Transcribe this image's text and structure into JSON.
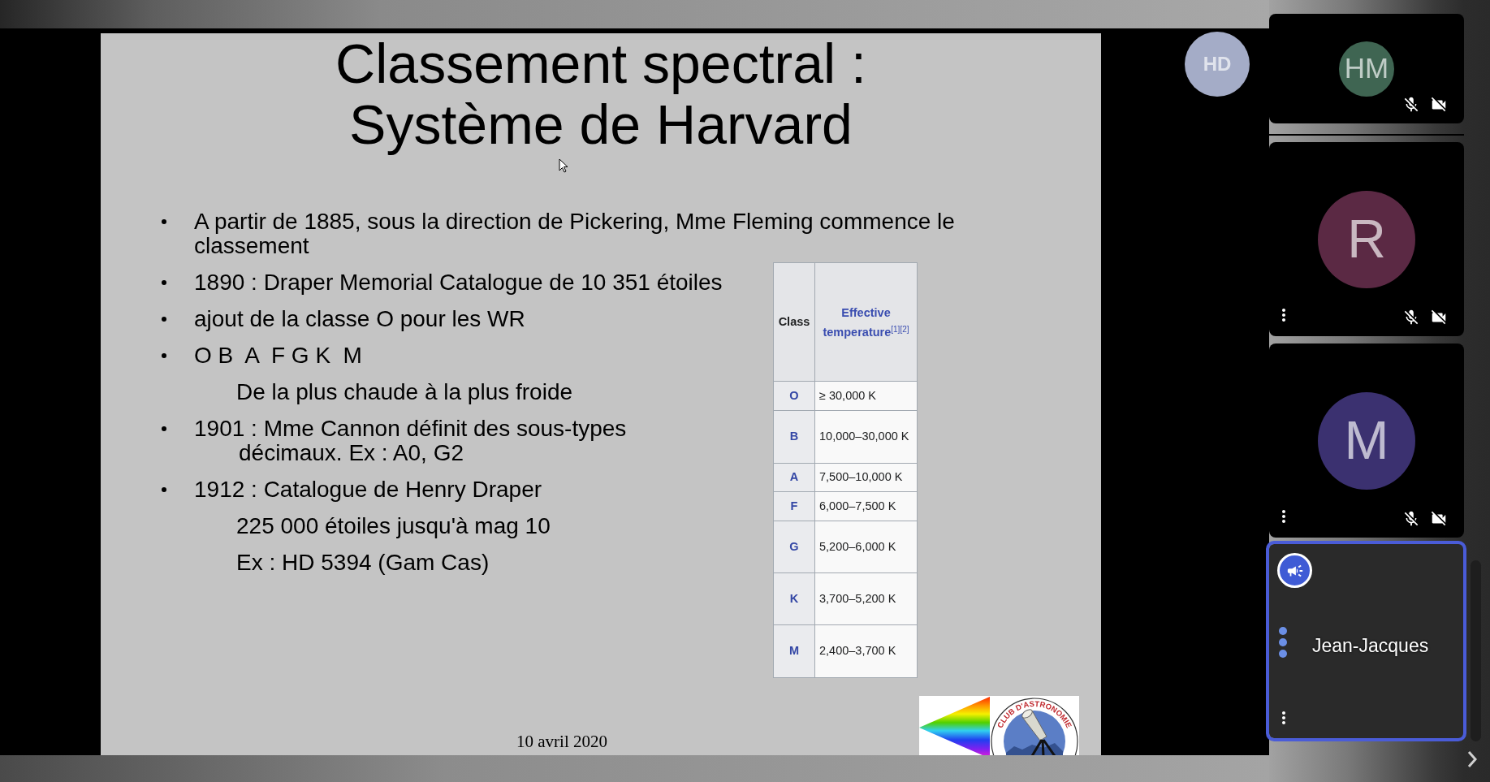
{
  "stage": {
    "avatar": {
      "initials": "HD"
    }
  },
  "slide": {
    "title": "Classement spectral : Système de Harvard",
    "bullets": [
      {
        "kind": "bullet",
        "text": "A partir de 1885, sous la direction de Pickering, Mme Fleming commence le classement"
      },
      {
        "kind": "bullet",
        "text": "1890 : Draper Memorial Catalogue de 10 351 étoiles"
      },
      {
        "kind": "bullet",
        "text": "ajout de la classe O pour les WR"
      },
      {
        "kind": "bullet",
        "text": "O B  A  F G K  M"
      },
      {
        "kind": "sub",
        "text": "De la plus chaude à la plus froide"
      },
      {
        "kind": "bullet",
        "text": "1901 : Mme Cannon définit des sous-types\ndécimaux. Ex : A0, G2"
      },
      {
        "kind": "bullet",
        "text": "1912 : Catalogue de Henry Draper"
      },
      {
        "kind": "sub",
        "text": "225 000 étoiles jusqu'à mag 10"
      },
      {
        "kind": "sub",
        "text": "Ex : HD 5394 (Gam Cas)"
      }
    ],
    "table": {
      "columns": [
        "Class",
        "Effective temperature$^{[1][2]}$"
      ],
      "rows": [
        {
          "class": "O",
          "temperature": "≥ 30,000 K"
        },
        {
          "class": "B",
          "temperature": "10,000–30,000 K"
        },
        {
          "class": "A",
          "temperature": "7,500–10,000 K"
        },
        {
          "class": "F",
          "temperature": "6,000–7,500 K"
        },
        {
          "class": "G",
          "temperature": "5,200–6,000 K"
        },
        {
          "class": "K",
          "temperature": "3,700–5,200 K"
        },
        {
          "class": "M",
          "temperature": "2,400–3,700 K"
        }
      ]
    },
    "date": "10 avril 2020",
    "logo": {
      "text": "CLUB D'ASTRONOMIE"
    }
  },
  "filmstrip": {
    "participants": [
      {
        "kind": "local",
        "initials": "HM",
        "color": "#3f6552",
        "audio_muted": true,
        "video_muted": true,
        "menu_button": false,
        "active_speaker": false
      },
      {
        "kind": "remote",
        "initials": "R",
        "color": "#5b2944",
        "audio_muted": true,
        "video_muted": true,
        "menu_button": true,
        "active_speaker": false
      },
      {
        "kind": "remote",
        "initials": "M",
        "color": "#3b3170",
        "audio_muted": true,
        "video_muted": true,
        "menu_button": true,
        "active_speaker": false
      },
      {
        "kind": "screen_share",
        "name": "Jean-Jacques",
        "presenter": true,
        "speaking": true,
        "menu_button": true,
        "active_speaker": true
      }
    ]
  }
}
